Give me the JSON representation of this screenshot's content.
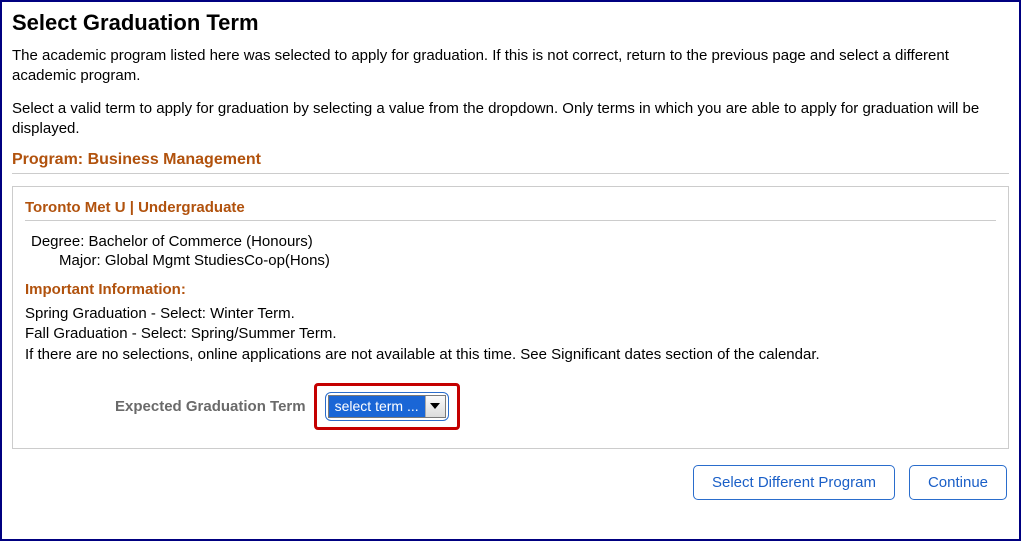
{
  "title": "Select Graduation Term",
  "intro": {
    "p1": "The academic program listed here was selected to apply for graduation. If this is not correct, return to the previous page and select a different academic program.",
    "p2": "Select a valid term to apply for graduation by selecting a value from the dropdown. Only terms in which you are able to apply for graduation will be displayed."
  },
  "program_heading": "Program: Business Management",
  "institution_heading": "Toronto Met U | Undergraduate",
  "degree_line": "Degree: Bachelor of Commerce (Honours)",
  "major_line": "Major: Global Mgmt StudiesCo-op(Hons)",
  "important_heading": "Important Information:",
  "info": {
    "line1": "Spring Graduation - Select: Winter Term.",
    "line2": "Fall Graduation - Select: Spring/Summer Term.",
    "line3": "If there are no selections, online applications are not available at this time. See Significant dates section of the calendar."
  },
  "term_label": "Expected Graduation Term",
  "select_value": "select term ...",
  "buttons": {
    "select_different": "Select Different Program",
    "continue": "Continue"
  }
}
